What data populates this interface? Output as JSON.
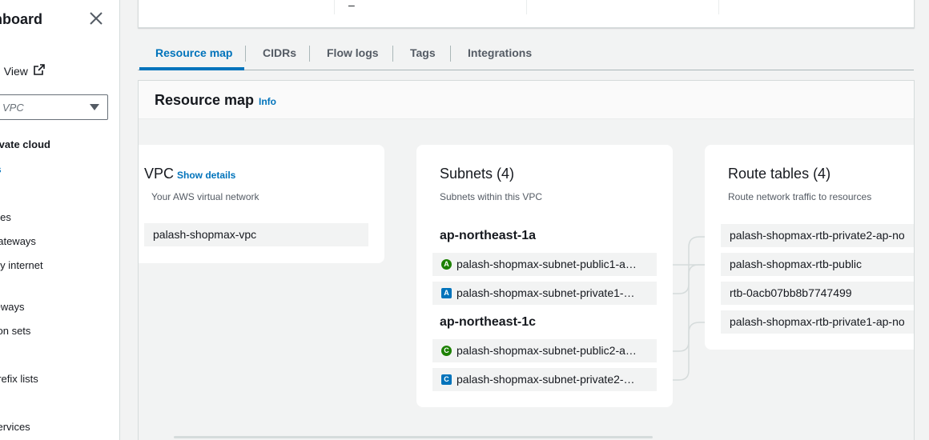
{
  "sidebar": {
    "title": "shboard",
    "global_view": "al View",
    "vpc_select_value": "VPC",
    "section_title": "rivate cloud",
    "items": [
      {
        "label": "ts",
        "active": true
      },
      {
        "label": "bles"
      },
      {
        "label": "gateways"
      },
      {
        "label": "nly internet"
      },
      {
        "label": "teways"
      },
      {
        "label": "tion sets"
      },
      {
        "label": "s"
      },
      {
        "label": "prefix lists"
      },
      {
        "label": "s"
      },
      {
        "label": "services"
      }
    ]
  },
  "top_card": {
    "dash": "–"
  },
  "tabs": [
    {
      "label": "Resource map",
      "active": true
    },
    {
      "label": "CIDRs"
    },
    {
      "label": "Flow logs"
    },
    {
      "label": "Tags"
    },
    {
      "label": "Integrations"
    }
  ],
  "resource_map": {
    "title": "Resource map",
    "info": "Info",
    "vpc": {
      "title": "VPC",
      "show_details": "Show details",
      "subtitle": "Your AWS virtual network",
      "name": "palash-shopmax-vpc"
    },
    "subnets": {
      "title": "Subnets (4)",
      "subtitle": "Subnets within this VPC",
      "zones": [
        {
          "name": "ap-northeast-1a",
          "items": [
            {
              "badge": "A",
              "type": "public",
              "label": "palash-shopmax-subnet-public1-a…"
            },
            {
              "badge": "A",
              "type": "private",
              "label": "palash-shopmax-subnet-private1-…"
            }
          ]
        },
        {
          "name": "ap-northeast-1c",
          "items": [
            {
              "badge": "C",
              "type": "public",
              "label": "palash-shopmax-subnet-public2-a…"
            },
            {
              "badge": "C",
              "type": "private",
              "label": "palash-shopmax-subnet-private2-…"
            }
          ]
        }
      ]
    },
    "route_tables": {
      "title": "Route tables (4)",
      "subtitle": "Route network traffic to resources",
      "items": [
        "palash-shopmax-rtb-private2-ap-no",
        "palash-shopmax-rtb-public",
        "rtb-0acb07bb8b7747499",
        "palash-shopmax-rtb-private1-ap-no"
      ]
    }
  },
  "colors": {
    "accent": "#0073bb",
    "public_badge": "#1d8102",
    "private_badge": "#0073bb"
  }
}
